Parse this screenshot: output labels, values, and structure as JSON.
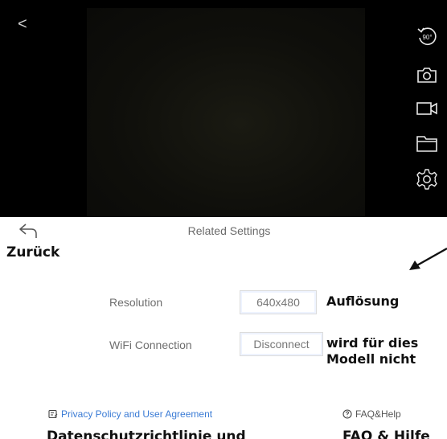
{
  "camera": {
    "back_glyph": "<",
    "icons": [
      "rotate-90-icon",
      "camera-snapshot-icon",
      "video-record-icon",
      "folder-icon",
      "settings-gear-icon"
    ],
    "rotate_label": "90°"
  },
  "settings": {
    "title": "Related Settings",
    "back_annotation": "Zurück",
    "rows": [
      {
        "label": "Resolution",
        "value": "640x480",
        "annotation": "Auflösung"
      },
      {
        "label": "WiFi Connection",
        "value": "Disconnect",
        "annotation_line1": "wird für dies",
        "annotation_line2": "Modell nicht"
      }
    ]
  },
  "footer": {
    "privacy_label": "Privacy Policy and User Agreement",
    "faq_label": "FAQ&Help",
    "privacy_annotation": "Datenschutzrichtlinie und",
    "faq_annotation": "FAQ & Hilfe"
  },
  "colors": {
    "link_blue": "#3a7bd5",
    "label_gray": "#6e6e6e",
    "camera_bg": "#000000"
  }
}
